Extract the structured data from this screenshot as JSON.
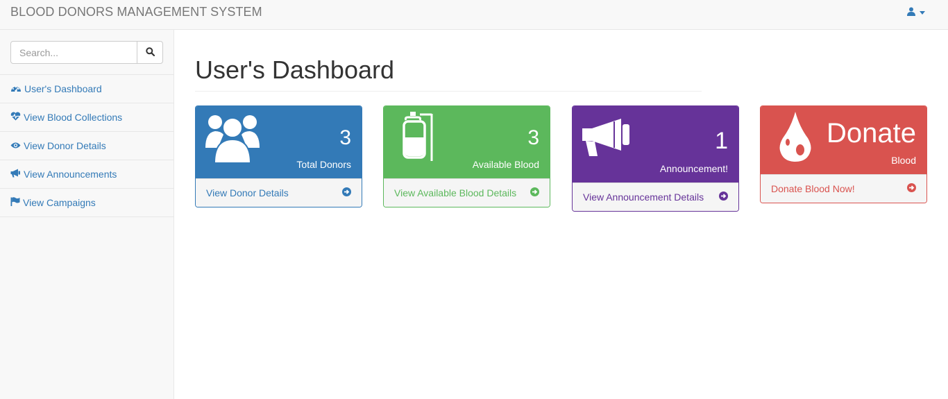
{
  "app": {
    "title": "BLOOD DONORS MANAGEMENT SYSTEM"
  },
  "search": {
    "placeholder": "Search...",
    "value": ""
  },
  "sidebar": {
    "items": [
      {
        "label": "User's Dashboard",
        "icon": "dashboard-icon"
      },
      {
        "label": "View Blood Collections",
        "icon": "heartbeat-icon"
      },
      {
        "label": "View Donor Details",
        "icon": "eye-icon"
      },
      {
        "label": "View Announcements",
        "icon": "bullhorn-icon"
      },
      {
        "label": "View Campaigns",
        "icon": "flag-icon"
      }
    ]
  },
  "main": {
    "title": "User's Dashboard",
    "panels": [
      {
        "value": "3",
        "label": "Total Donors",
        "link": "View Donor Details",
        "icon": "users-icon",
        "color": "#337ab7"
      },
      {
        "value": "3",
        "label": "Available Blood",
        "link": "View Available Blood Details",
        "icon": "blood-bag-icon",
        "color": "#5cb85c"
      },
      {
        "value": "1",
        "label": "Announcement!",
        "link": "View Announcement Details",
        "icon": "bullhorn-icon",
        "color": "#663399"
      },
      {
        "value": "Donate",
        "label": "Blood",
        "link": "Donate Blood Now!",
        "icon": "blood-drop-icon",
        "color": "#d9534f"
      }
    ]
  },
  "colors": {
    "link": "#337ab7",
    "navbar_bg": "#f8f8f8",
    "border": "#e7e7e7"
  }
}
